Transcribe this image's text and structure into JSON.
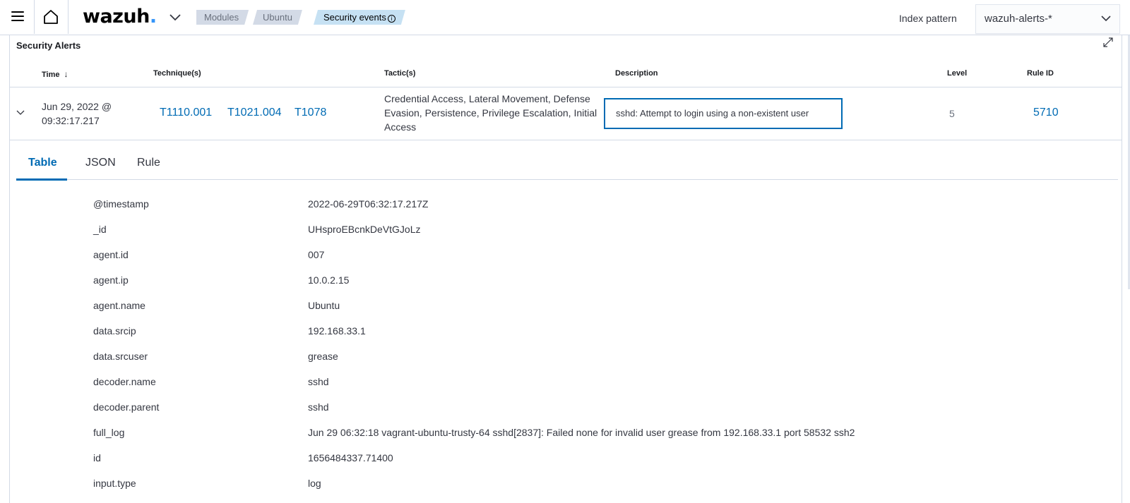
{
  "header": {
    "logo_text": "wazuh",
    "logo_dot": ".",
    "breadcrumbs": [
      "Modules",
      "Ubuntu",
      "Security events"
    ],
    "index_pattern_label": "Index pattern",
    "index_pattern_value": "wazuh-alerts-*"
  },
  "panel": {
    "title": "Security Alerts",
    "columns": {
      "time": "Time",
      "techniques": "Technique(s)",
      "tactics": "Tactic(s)",
      "description": "Description",
      "level": "Level",
      "rule_id": "Rule ID"
    },
    "row": {
      "time": "Jun 29, 2022 @ 09:32:17.217",
      "techniques": [
        "T1110.001",
        "T1021.004",
        "T1078"
      ],
      "tactics": "Credential Access, Lateral Movement, Defense Evasion, Persistence, Privilege Escalation, Initial Access",
      "description": "sshd: Attempt to login using a non-existent user",
      "level": "5",
      "rule_id": "5710"
    }
  },
  "tabs": [
    "Table",
    "JSON",
    "Rule"
  ],
  "active_tab": "Table",
  "fields": [
    {
      "key": "@timestamp",
      "value": "2022-06-29T06:32:17.217Z"
    },
    {
      "key": "_id",
      "value": "UHsproEBcnkDeVtGJoLz"
    },
    {
      "key": "agent.id",
      "value": "007"
    },
    {
      "key": "agent.ip",
      "value": "10.0.2.15"
    },
    {
      "key": "agent.name",
      "value": "Ubuntu"
    },
    {
      "key": "data.srcip",
      "value": "192.168.33.1"
    },
    {
      "key": "data.srcuser",
      "value": "grease"
    },
    {
      "key": "decoder.name",
      "value": "sshd"
    },
    {
      "key": "decoder.parent",
      "value": "sshd"
    },
    {
      "key": "full_log",
      "value": "Jun 29 06:32:18 vagrant-ubuntu-trusty-64 sshd[2837]: Failed none for invalid user grease from 192.168.33.1 port 58532 ssh2"
    },
    {
      "key": "id",
      "value": "1656484337.71400"
    },
    {
      "key": "input.type",
      "value": "log"
    }
  ],
  "colors": {
    "link": "#006bb4",
    "logo_dot": "#3595f9",
    "active_breadcrumb": "#c6e1f3",
    "breadcrumb": "#d3dae6"
  },
  "icons": [
    "menu-icon",
    "home-icon",
    "chevron-down-icon",
    "info-icon",
    "expand-icon",
    "sort-down-icon"
  ]
}
